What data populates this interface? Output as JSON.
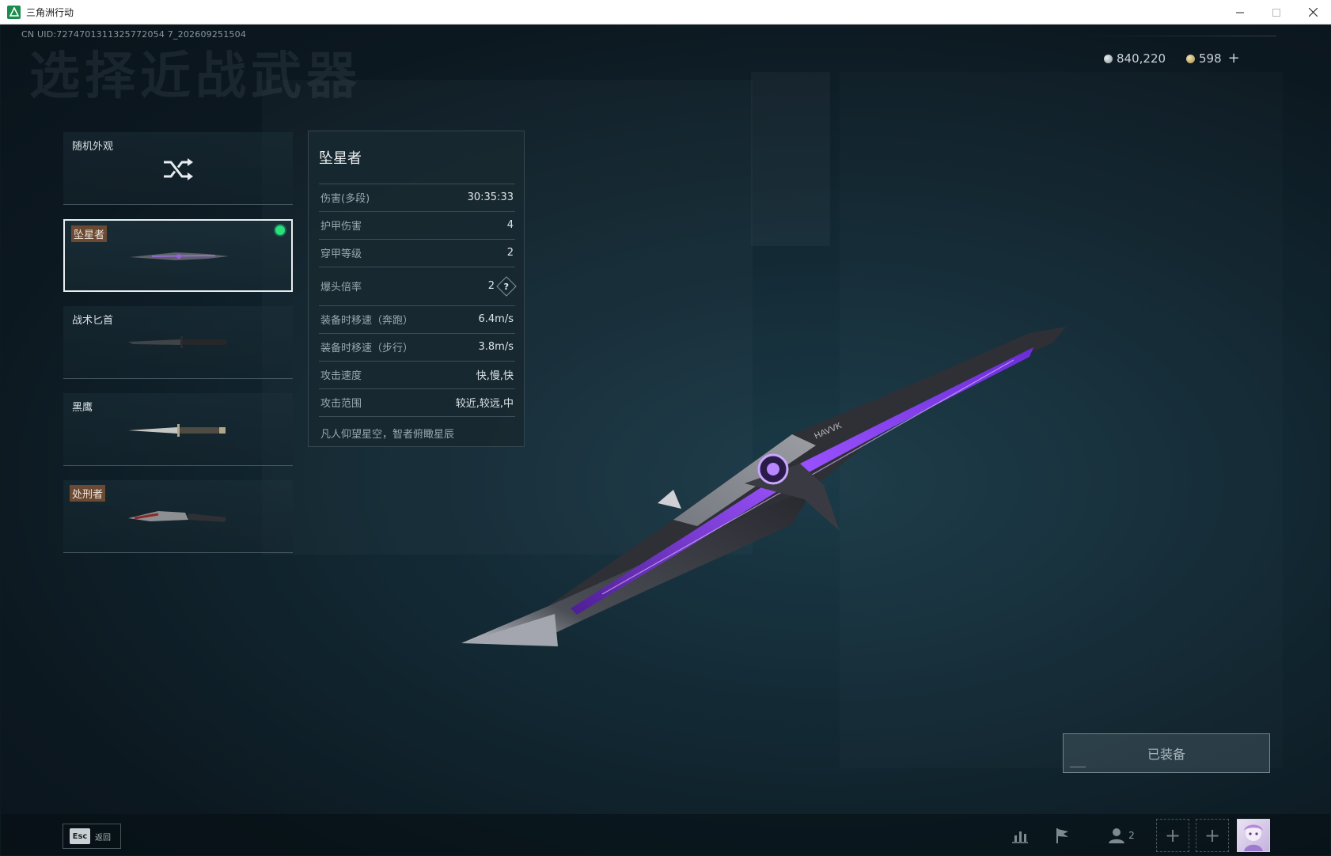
{
  "window": {
    "title": "三角洲行动",
    "controls": {
      "minimize": "minimize-icon",
      "maximize": "maximize-icon",
      "close": "close-icon"
    }
  },
  "header": {
    "uid": "CN UID:7274701311325772054 7_202609251504",
    "page_title": "选择近战武器"
  },
  "currency": {
    "silver": {
      "icon": "silver-coin-icon",
      "amount": "840,220"
    },
    "gold": {
      "icon": "gold-coin-icon",
      "amount": "598"
    },
    "add_icon": "+"
  },
  "weapon_list": {
    "random": {
      "label": "随机外观",
      "icon": "shuffle-icon"
    },
    "items": [
      {
        "label": "坠星者",
        "tagged": true,
        "selected": true,
        "equipped": true
      },
      {
        "label": "战术匕首",
        "tagged": false,
        "selected": false,
        "equipped": false
      },
      {
        "label": "黑鹰",
        "tagged": false,
        "selected": false,
        "equipped": false
      },
      {
        "label": "处刑者",
        "tagged": true,
        "selected": false,
        "equipped": false
      }
    ]
  },
  "stats": {
    "name": "坠星者",
    "rows": [
      {
        "label": "伤害(多段)",
        "value": "30:35:33"
      },
      {
        "label": "护甲伤害",
        "value": "4"
      },
      {
        "label": "穿甲等级",
        "value": "2"
      },
      {
        "label": "爆头倍率",
        "value": "2",
        "help": "?"
      },
      {
        "label": "装备时移速（奔跑）",
        "value": "6.4m/s"
      },
      {
        "label": "装备时移速（步行）",
        "value": "3.8m/s"
      },
      {
        "label": "攻击速度",
        "value": "快,慢,快"
      },
      {
        "label": "攻击范围",
        "value": "较近,较远,中"
      }
    ],
    "description": "凡人仰望星空，智者俯瞰星辰"
  },
  "showcase": {
    "engraving": "HAVVK"
  },
  "actions": {
    "equipped": "已装备"
  },
  "bottom_bar": {
    "esc_key": "Esc",
    "back": "返回",
    "friends_count": "2",
    "icons": [
      "stats-icon",
      "flag-icon",
      "friends-icon"
    ]
  },
  "colors": {
    "accent_equipped": "#29e07d",
    "tag_bg": "#6b4a34",
    "blade_purple": "#8a3fe0"
  }
}
